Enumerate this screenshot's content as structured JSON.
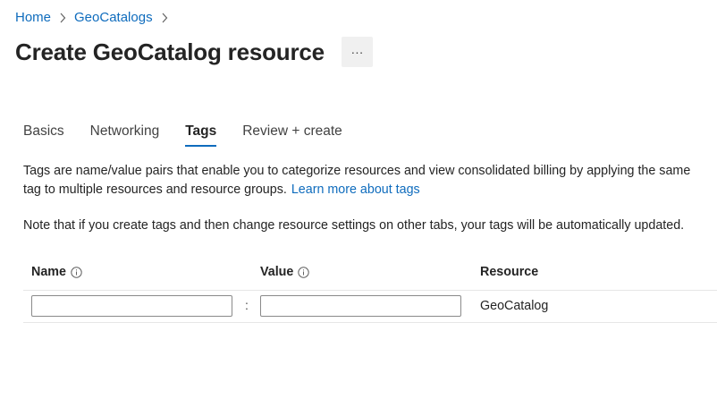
{
  "breadcrumb": {
    "items": [
      {
        "label": "Home"
      },
      {
        "label": "GeoCatalogs"
      }
    ]
  },
  "header": {
    "title": "Create GeoCatalog resource",
    "more_label": "···"
  },
  "tabs": [
    {
      "label": "Basics",
      "active": false
    },
    {
      "label": "Networking",
      "active": false
    },
    {
      "label": "Tags",
      "active": true
    },
    {
      "label": "Review + create",
      "active": false
    }
  ],
  "description": {
    "text": "Tags are name/value pairs that enable you to categorize resources and view consolidated billing by applying the same tag to multiple resources and resource groups.",
    "link": "Learn more about tags"
  },
  "note": "Note that if you create tags and then change resource settings on other tabs, your tags will be automatically updated.",
  "table": {
    "headers": {
      "name": "Name",
      "value": "Value",
      "resource": "Resource"
    },
    "rows": [
      {
        "name_value": "",
        "value_value": "",
        "separator": ":",
        "resource": "GeoCatalog"
      }
    ]
  },
  "colors": {
    "accent": "#0f6cbd",
    "text": "#242424"
  }
}
